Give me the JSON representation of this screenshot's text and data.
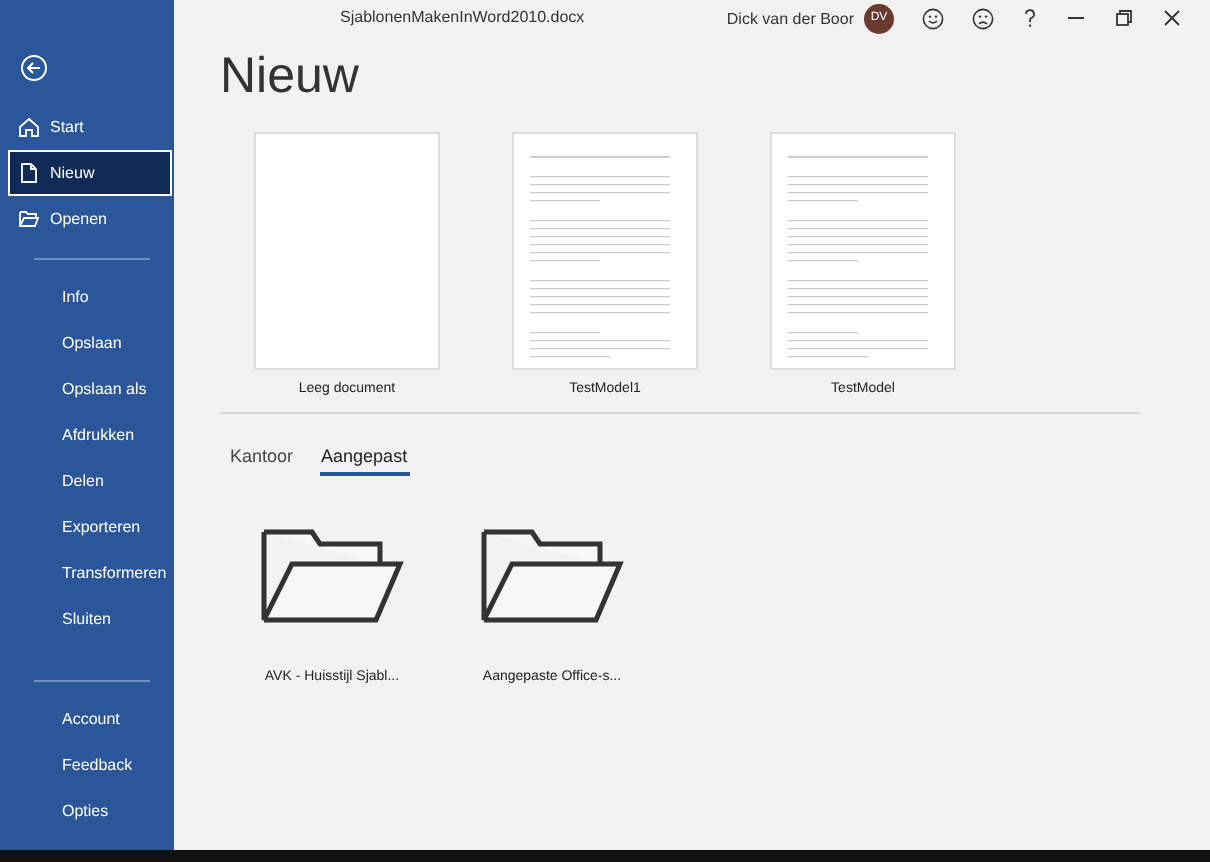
{
  "window": {
    "title": "SjablonenMakenInWord2010.docx",
    "user": "Dick van der Boor",
    "initials": "DV"
  },
  "sidebar": {
    "top": [
      {
        "label": "Start",
        "kind": "home",
        "selected": false
      },
      {
        "label": "Nieuw",
        "kind": "document",
        "selected": true
      },
      {
        "label": "Openen",
        "kind": "folder",
        "selected": false
      }
    ],
    "middle": [
      {
        "label": "Info",
        "selected": false
      },
      {
        "label": "Opslaan",
        "selected": false
      },
      {
        "label": "Opslaan als",
        "selected": false
      },
      {
        "label": "Afdrukken",
        "selected": false
      },
      {
        "label": "Delen",
        "selected": false
      },
      {
        "label": "Exporteren",
        "selected": false
      },
      {
        "label": "Transformeren",
        "selected": false
      },
      {
        "label": "Sluiten",
        "selected": false
      }
    ],
    "bottom": [
      {
        "label": "Account",
        "selected": false
      },
      {
        "label": "Feedback",
        "selected": false
      },
      {
        "label": "Opties",
        "selected": false
      }
    ]
  },
  "page": {
    "heading": "Nieuw",
    "templates": [
      {
        "label": "Leeg document",
        "kind": "blank"
      },
      {
        "label": "TestModel1",
        "kind": "lined"
      },
      {
        "label": "TestModel",
        "kind": "lined"
      }
    ],
    "tabs": [
      {
        "label": "Kantoor",
        "selected": false
      },
      {
        "label": "Aangepast",
        "selected": true
      }
    ],
    "folders": [
      {
        "label": "AVK - Huisstijl Sjabl..."
      },
      {
        "label": "Aangepaste Office-s..."
      }
    ]
  }
}
